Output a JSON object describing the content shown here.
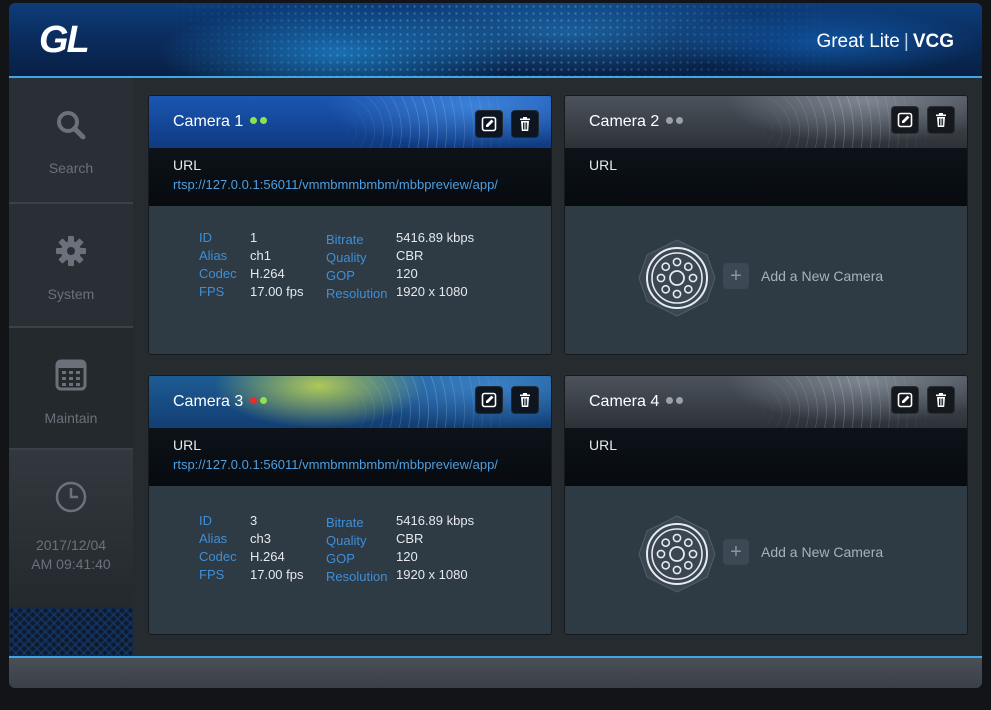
{
  "header": {
    "logo": "GL",
    "brand": "Great Lite",
    "separator": "|",
    "product": "VCG"
  },
  "sidebar": {
    "items": [
      {
        "label": "Search",
        "icon": "search-icon"
      },
      {
        "label": "System",
        "icon": "gear-icon"
      },
      {
        "label": "Maintain",
        "icon": "calendar-grid-icon"
      }
    ],
    "clock": {
      "icon": "clock-icon",
      "date": "2017/12/04",
      "time": "AM 09:41:40"
    }
  },
  "cameras": [
    {
      "title": "Camera 1",
      "status": [
        "green",
        "green"
      ],
      "url_label": "URL",
      "url": "rtsp://127.0.0.1:56011/vmmbmmbmbm/mbbpreview/app/",
      "fields_left": [
        {
          "label": "ID",
          "value": "1"
        },
        {
          "label": "Alias",
          "value": "ch1"
        },
        {
          "label": "Codec",
          "value": "H.264"
        },
        {
          "label": "FPS",
          "value": "17.00 fps"
        }
      ],
      "fields_right": [
        {
          "label": "Bitrate",
          "value": "5416.89 kbps"
        },
        {
          "label": "Quality",
          "value": "CBR"
        },
        {
          "label": "GOP",
          "value": "120"
        },
        {
          "label": "Resolution",
          "value": "1920 x 1080"
        }
      ]
    },
    {
      "title": "Camera 2",
      "status": [
        "gray",
        "gray"
      ],
      "url_label": "URL",
      "url": "",
      "add_label": "Add a New Camera",
      "add_symbol": "+"
    },
    {
      "title": "Camera 3",
      "status": [
        "red",
        "green"
      ],
      "url_label": "URL",
      "url": "rtsp://127.0.0.1:56011/vmmbmmbmbm/mbbpreview/app/",
      "fields_left": [
        {
          "label": "ID",
          "value": "3"
        },
        {
          "label": "Alias",
          "value": "ch3"
        },
        {
          "label": "Codec",
          "value": "H.264"
        },
        {
          "label": "FPS",
          "value": "17.00 fps"
        }
      ],
      "fields_right": [
        {
          "label": "Bitrate",
          "value": "5416.89 kbps"
        },
        {
          "label": "Quality",
          "value": "CBR"
        },
        {
          "label": "GOP",
          "value": "120"
        },
        {
          "label": "Resolution",
          "value": "1920 x 1080"
        }
      ]
    },
    {
      "title": "Camera 4",
      "status": [
        "gray",
        "gray"
      ],
      "url_label": "URL",
      "url": "",
      "add_label": "Add a New Camera",
      "add_symbol": "+"
    }
  ],
  "colors": {
    "accent": "#3fa7e8",
    "field_label": "#3f8fd8",
    "url": "#4f9fe0",
    "status_green": "#8fe34a",
    "status_red": "#ee2a2a",
    "status_idle": "#9aa1a9"
  }
}
